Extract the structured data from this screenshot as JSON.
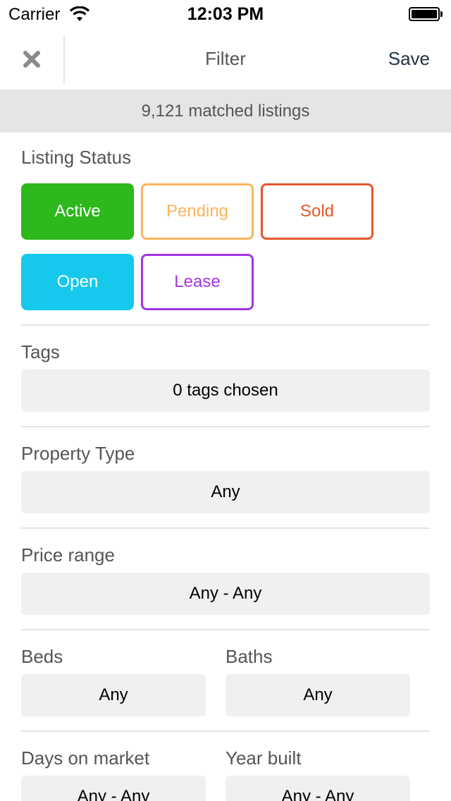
{
  "status_bar": {
    "carrier": "Carrier",
    "time": "12:03 PM",
    "icons": [
      "wifi-icon",
      "battery-icon"
    ]
  },
  "nav": {
    "title": "Filter",
    "save_label": "Save",
    "close_icon": "close-icon"
  },
  "matched_text": "9,121 matched listings",
  "listing_status": {
    "label": "Listing Status",
    "buttons": [
      {
        "label": "Active",
        "color": "#2db81c",
        "selected": true
      },
      {
        "label": "Pending",
        "color": "#fcb45a",
        "selected": false
      },
      {
        "label": "Sold",
        "color": "#e5572a",
        "selected": false
      },
      {
        "label": "Open",
        "color": "#16c9ec",
        "selected": true
      },
      {
        "label": "Lease",
        "color": "#a335e3",
        "selected": false
      }
    ]
  },
  "tags": {
    "label": "Tags",
    "value": "0 tags chosen"
  },
  "property_type": {
    "label": "Property Type",
    "value": "Any"
  },
  "price_range": {
    "label": "Price range",
    "value": "Any - Any"
  },
  "beds": {
    "label": "Beds",
    "value": "Any"
  },
  "baths": {
    "label": "Baths",
    "value": "Any"
  },
  "days_on_market": {
    "label": "Days on market",
    "value": "Any - Any"
  },
  "year_built": {
    "label": "Year built",
    "value": "Any - Any"
  }
}
